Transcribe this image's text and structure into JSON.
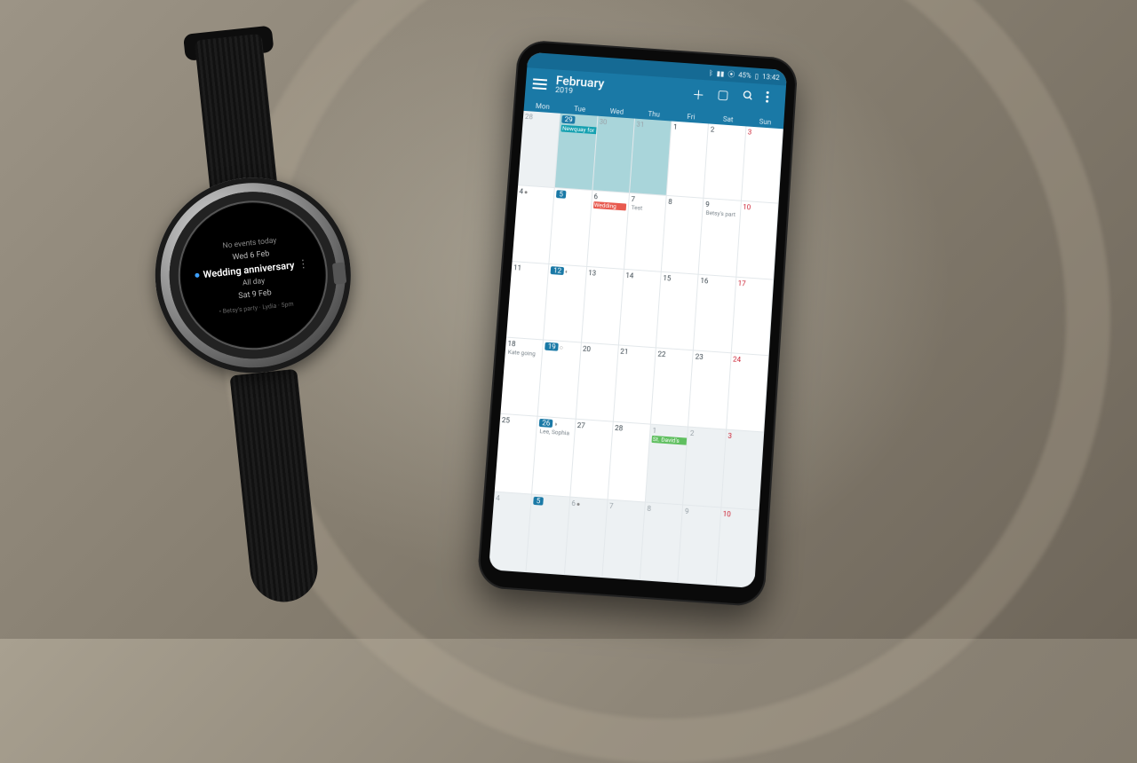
{
  "watch": {
    "no_events": "No events today",
    "date1": "Wed 6 Feb",
    "event_title": "Wedding anniversary",
    "event_sub": "All day",
    "date2": "Sat 9 Feb",
    "footer": "• Betsy's party · Lydia · 5pm"
  },
  "phone": {
    "status": {
      "battery": "45%",
      "time": "13:42"
    },
    "appbar": {
      "month": "February",
      "year": "2019"
    },
    "dow": [
      "Mon",
      "Tue",
      "Wed",
      "Thu",
      "Fri",
      "Sat",
      "Sun"
    ],
    "weeks": [
      [
        {
          "n": "28",
          "grey": true
        },
        {
          "n": "29",
          "grey": true,
          "today": true
        },
        {
          "n": "30",
          "grey": true
        },
        {
          "n": "31",
          "grey": true
        },
        {
          "n": "1"
        },
        {
          "n": "2"
        },
        {
          "n": "3",
          "sun": true
        }
      ],
      [
        {
          "n": "4",
          "moon": "●"
        },
        {
          "n": "5",
          "today": true
        },
        {
          "n": "6"
        },
        {
          "n": "7"
        },
        {
          "n": "8"
        },
        {
          "n": "9"
        },
        {
          "n": "10",
          "sun": true
        }
      ],
      [
        {
          "n": "11"
        },
        {
          "n": "12",
          "moon": "◐",
          "today": true
        },
        {
          "n": "13"
        },
        {
          "n": "14"
        },
        {
          "n": "15"
        },
        {
          "n": "16"
        },
        {
          "n": "17",
          "sun": true
        }
      ],
      [
        {
          "n": "18"
        },
        {
          "n": "19",
          "moon": "○",
          "today": true
        },
        {
          "n": "20"
        },
        {
          "n": "21"
        },
        {
          "n": "22"
        },
        {
          "n": "23"
        },
        {
          "n": "24",
          "sun": true
        }
      ],
      [
        {
          "n": "25"
        },
        {
          "n": "26",
          "moon": "◑",
          "today": true
        },
        {
          "n": "27"
        },
        {
          "n": "28"
        },
        {
          "n": "1",
          "grey": true
        },
        {
          "n": "2",
          "grey": true
        },
        {
          "n": "3",
          "grey": true,
          "sun": true
        }
      ],
      [
        {
          "n": "4",
          "grey": true
        },
        {
          "n": "5",
          "grey": true,
          "today": true
        },
        {
          "n": "6",
          "grey": true,
          "moon": "●"
        },
        {
          "n": "7",
          "grey": true
        },
        {
          "n": "8",
          "grey": true
        },
        {
          "n": "9",
          "grey": true
        },
        {
          "n": "10",
          "grey": true,
          "sun": true
        }
      ]
    ],
    "events": {
      "w0_newquay": "Newquay for seminar",
      "w1_wedding": "Wedding",
      "w1_test": "Test",
      "w1_betsy": "Betsy's part",
      "w3_kate": "Kate going",
      "w4_lee": "Lee, Sophia",
      "w4_stdavid": "St. David's"
    }
  }
}
